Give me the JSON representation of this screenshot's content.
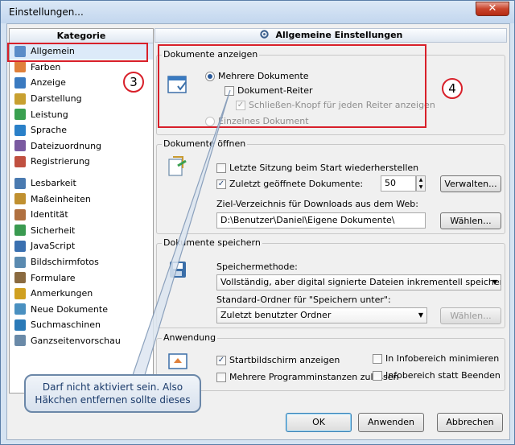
{
  "window": {
    "title": "Einstellungen...",
    "close_label": "✕"
  },
  "left_panel": {
    "header": "Kategorie",
    "items": [
      {
        "label": "Allgemein",
        "icon": "settings-icon",
        "color": "#5a8cc8",
        "selected": true
      },
      {
        "label": "Farben",
        "icon": "palette-icon",
        "color": "#e0803a"
      },
      {
        "label": "Anzeige",
        "icon": "display-icon",
        "color": "#3a7ac0"
      },
      {
        "label": "Darstellung",
        "icon": "brush-icon",
        "color": "#c8a030"
      },
      {
        "label": "Leistung",
        "icon": "performance-icon",
        "color": "#3aa050"
      },
      {
        "label": "Sprache",
        "icon": "language-icon",
        "color": "#2a80c8"
      },
      {
        "label": "Dateizuordnung",
        "icon": "file-association-icon",
        "color": "#7a5aa0"
      },
      {
        "label": "Registrierung",
        "icon": "registration-icon",
        "color": "#c05040"
      },
      {
        "label": "Lesbarkeit",
        "icon": "readability-icon",
        "color": "#4a7ab0",
        "gap": true
      },
      {
        "label": "Maßeinheiten",
        "icon": "ruler-icon",
        "color": "#c09030"
      },
      {
        "label": "Identität",
        "icon": "identity-icon",
        "color": "#b07040"
      },
      {
        "label": "Sicherheit",
        "icon": "security-icon",
        "color": "#3a9a50"
      },
      {
        "label": "JavaScript",
        "icon": "javascript-icon",
        "color": "#3a70b0"
      },
      {
        "label": "Bildschirmfotos",
        "icon": "screenshot-icon",
        "color": "#5a8ab0"
      },
      {
        "label": "Formulare",
        "icon": "forms-icon",
        "color": "#8a6a40"
      },
      {
        "label": "Anmerkungen",
        "icon": "annotation-icon",
        "color": "#d0a020"
      },
      {
        "label": "Neue Dokumente",
        "icon": "new-document-icon",
        "color": "#4a90c0"
      },
      {
        "label": "Suchmaschinen",
        "icon": "search-engine-icon",
        "color": "#2a7ab8"
      },
      {
        "label": "Ganzseitenvorschau",
        "icon": "full-page-preview-icon",
        "color": "#6a8aa8"
      }
    ]
  },
  "right_panel": {
    "header": "Allgemeine Einstellungen",
    "header_icon": "settings-icon",
    "group_display": {
      "title": "Dokumente anzeigen",
      "radio_multiple": "Mehrere Dokumente",
      "cb_tabs": "Dokument-Reiter",
      "cb_close_button": "Schließen-Knopf für jeden Reiter anzeigen",
      "radio_single": "Einzelnes Dokument"
    },
    "group_open": {
      "title": "Dokumente öffnen",
      "cb_restore": "Letzte Sitzung beim Start wiederherstellen",
      "cb_recent": "Zuletzt geöffnete Dokumente:",
      "recent_count": "50",
      "manage_button": "Verwalten...",
      "download_label": "Ziel-Verzeichnis für Downloads aus dem Web:",
      "download_path": "D:\\Benutzer\\Daniel\\Eigene Dokumente\\",
      "choose_button": "Wählen..."
    },
    "group_save": {
      "title": "Dokumente speichern",
      "method_label": "Speichermethode:",
      "method_value": "Vollständig, aber digital signierte Dateien inkrementell speichern",
      "folder_label": "Standard-Ordner für \"Speichern unter\":",
      "folder_value": "Zuletzt benutzter Ordner",
      "choose_button": "Wählen..."
    },
    "group_app": {
      "title": "Anwendung",
      "cb_startscreen": "Startbildschirm anzeigen",
      "cb_multi_instance": "Mehrere Programminstanzen zulassen",
      "cb_minimize_tray": "In Infobereich minimieren",
      "cb_close_tray": "Infobereich statt Beenden"
    }
  },
  "buttons": {
    "ok": "OK",
    "apply": "Anwenden",
    "cancel": "Abbrechen"
  },
  "annotations": {
    "marker_3": "3",
    "marker_4": "4",
    "callout_line1": "Darf nicht aktiviert sein. Also",
    "callout_line2": "Häkchen entfernen sollte dieses"
  },
  "colors": {
    "annotation_red": "#d8202a",
    "selection": "#dceaf9"
  }
}
